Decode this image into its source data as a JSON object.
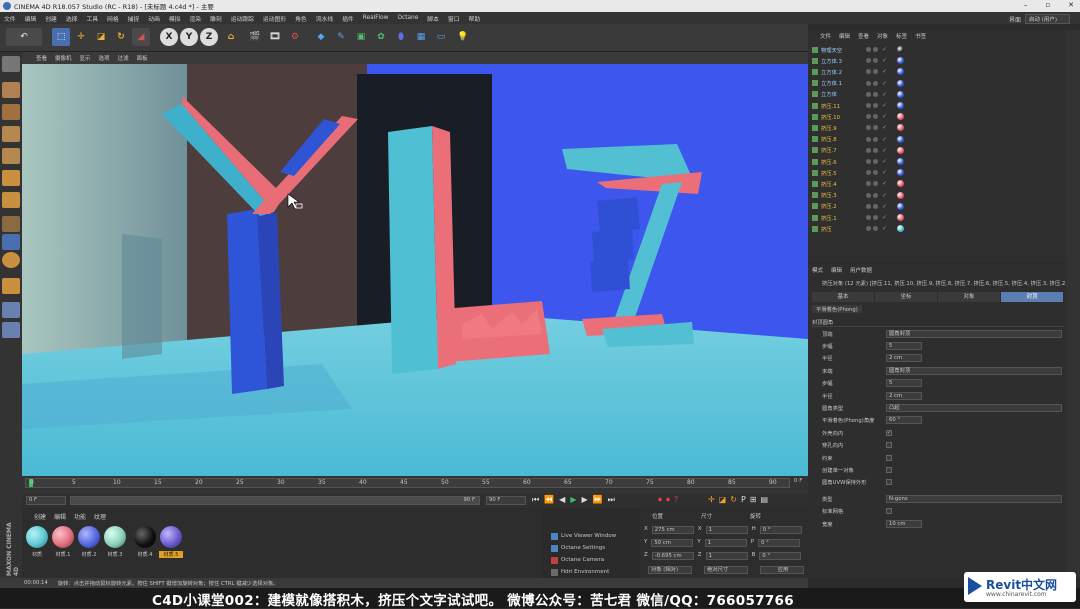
{
  "app": {
    "title": "CINEMA 4D R18.057 Studio (RC - R18) - [未标题 4.c4d *] - 主要"
  },
  "menubar": [
    "文件",
    "编辑",
    "创建",
    "选择",
    "工具",
    "网格",
    "捕捉",
    "动画",
    "模拟",
    "渲染",
    "雕刻",
    "运动跟踪",
    "运动图形",
    "角色",
    "流水线",
    "插件",
    "RealFlow",
    "Octane",
    "脚本",
    "窗口",
    "帮助"
  ],
  "layout": {
    "label": "界面",
    "value": "启动 (用户)"
  },
  "viewport": {
    "menus": [
      "查看",
      "摄像机",
      "显示",
      "选项",
      "过滤",
      "面板"
    ]
  },
  "timeline": {
    "ticks": [
      "0",
      "5",
      "10",
      "15",
      "20",
      "25",
      "30",
      "35",
      "40",
      "45",
      "50",
      "55",
      "60",
      "65",
      "70",
      "75",
      "80",
      "85",
      "90"
    ],
    "current": "0 F",
    "start": "0 F",
    "end": "90 F",
    "range_end": "90 F"
  },
  "materials": {
    "menus": [
      "创建",
      "编辑",
      "功能",
      "纹理"
    ],
    "items": [
      "材质",
      "材质.1",
      "材质.2",
      "材质.3",
      "材质.4",
      "材质.5"
    ],
    "colors": [
      "#5fc8d4",
      "#e07080",
      "#5566dd",
      "#8bd0b8",
      "#111111",
      "#6a5ccc"
    ]
  },
  "octane": [
    "Live Viewer Window",
    "Octane Settings",
    "Octane Camera",
    "Hdri Environment"
  ],
  "coords": {
    "headers": [
      "位置",
      "尺寸",
      "旋转"
    ],
    "rows": [
      {
        "axis": "X",
        "pos": "275 cm",
        "size": "1",
        "rot": "H",
        "rotval": "0 °"
      },
      {
        "axis": "Y",
        "pos": "50 cm",
        "size": "1",
        "rot": "P",
        "rotval": "0 °"
      },
      {
        "axis": "Z",
        "pos": "-0.695 cm",
        "size": "1",
        "rot": "B",
        "rotval": "0 °"
      }
    ],
    "mode1": "对象 (相对)",
    "mode2": "绝对尺寸",
    "apply": "应用"
  },
  "status": {
    "time": "00:00:14",
    "text": "旋转：点击并拖动鼠标旋转元素。按住 SHIFT 键增加旋转对象；按住 CTRL 键减少选择对象。"
  },
  "objmgr": {
    "menus": [
      "文件",
      "编辑",
      "查看",
      "对象",
      "标签",
      "书签"
    ],
    "objects": [
      {
        "name": "物理天空",
        "color": "#222"
      },
      {
        "name": "立方体.3",
        "color": "#2a4fd8"
      },
      {
        "name": "立方体.2",
        "color": "#2a4fd8"
      },
      {
        "name": "立方体.1",
        "color": "#2a4fd8"
      },
      {
        "name": "立方体",
        "color": "#2a4fd8"
      },
      {
        "name": "挤压.11",
        "color": "#2a4fd8"
      },
      {
        "name": "挤压.10",
        "color": "#e05060"
      },
      {
        "name": "挤压.9",
        "color": "#e05060"
      },
      {
        "name": "挤压.8",
        "color": "#2a4fd8"
      },
      {
        "name": "挤压.7",
        "color": "#e05060"
      },
      {
        "name": "挤压.6",
        "color": "#2a4fd8"
      },
      {
        "name": "挤压.5",
        "color": "#2a4fd8"
      },
      {
        "name": "挤压.4",
        "color": "#e05060"
      },
      {
        "name": "挤压.3",
        "color": "#e05060"
      },
      {
        "name": "挤压.2",
        "color": "#2a4fd8"
      },
      {
        "name": "挤压.1",
        "color": "#e05060"
      },
      {
        "name": "挤压",
        "color": "#3fb9c8"
      }
    ]
  },
  "attr": {
    "menus": [
      "模式",
      "编辑",
      "用户数据"
    ],
    "title": "挤压对象 (12 元素) [挤压.11, 挤压.10, 挤压.9, 挤压.8, 挤压.7, 挤压.6, 挤压.5, 挤压.4, 挤压.3, 挤压.2...]",
    "tabs": [
      "基本",
      "坐标",
      "对象",
      "封顶"
    ],
    "section1": "平滑着色(Phong)",
    "section2": "封顶圆角",
    "rows": [
      {
        "label": "顶端",
        "value": "圆角封顶",
        "type": "dd"
      },
      {
        "label": "步幅",
        "value": "5",
        "type": "num"
      },
      {
        "label": "半径",
        "value": "2 cm",
        "type": "num"
      },
      {
        "label": "末端",
        "value": "圆角封顶",
        "type": "dd"
      },
      {
        "label": "步幅",
        "value": "5",
        "type": "num"
      },
      {
        "label": "半径",
        "value": "2 cm",
        "type": "num"
      },
      {
        "label": "圆角类型",
        "value": "凸起",
        "type": "dd"
      },
      {
        "label": "平滑着色(Phong)角度",
        "value": "60 °",
        "type": "num"
      },
      {
        "label": "外壳向内",
        "value": "✓",
        "type": "chk"
      },
      {
        "label": "穿孔向内",
        "value": "",
        "type": "chk"
      },
      {
        "label": "约束",
        "value": "",
        "type": "chk"
      },
      {
        "label": "创建单一对象",
        "value": "",
        "type": "chk"
      },
      {
        "label": "圆角UVW保持外形",
        "value": "",
        "type": "chk"
      },
      {
        "label": "类型",
        "value": "N-gons",
        "type": "dd"
      },
      {
        "label": "标准网格",
        "value": "",
        "type": "chk"
      },
      {
        "label": "宽度",
        "value": "10 cm",
        "type": "num"
      }
    ]
  },
  "subtitle": "C4D小课堂002：建模就像搭积木，挤压个文字试试吧。    微博公众号：苦七君    微信/QQ：766057766",
  "watermark": {
    "line1": "Revit中文网",
    "line2": "www.chinarevit.com"
  },
  "maxon": "MAXON CINEMA 4D"
}
